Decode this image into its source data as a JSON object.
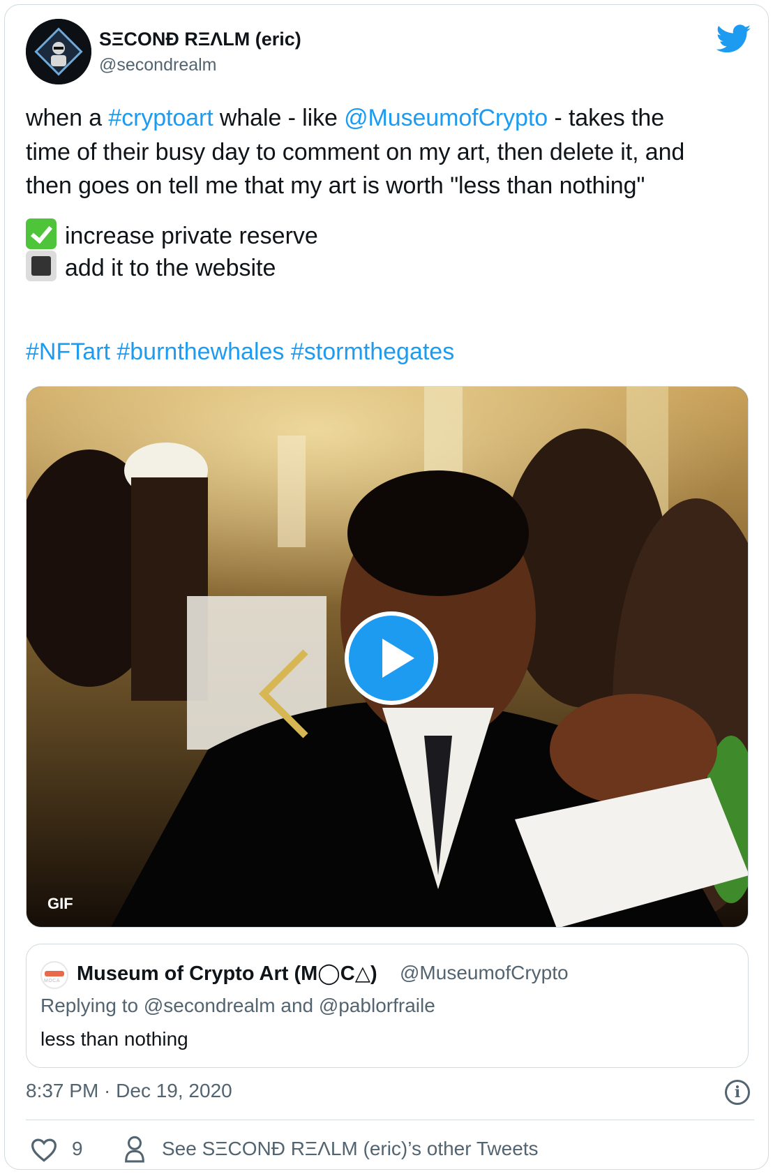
{
  "author": {
    "name": "SΞCONĐ RΞΛLM (eric)",
    "handle": "@secondrealm"
  },
  "tweet": {
    "line1": {
      "pre": "when a ",
      "tag": "#cryptoart",
      "mid": " whale - like ",
      "mention": "@MuseumofCrypto",
      "post": " - takes the"
    },
    "line2": "time of their busy day to comment on my art, then delete it, and",
    "line3": "then goes on tell me that my art is worth \"less than nothing\"",
    "checklist": [
      {
        "icon": "check-mark-button-emoji",
        "text": "increase private reserve"
      },
      {
        "icon": "black-square-button-emoji",
        "text": "add it to the website"
      }
    ],
    "hashtags": "#NFTart #burnthewhales #stormthegates"
  },
  "media": {
    "badge": "GIF",
    "play_icon": "play-icon"
  },
  "quoted": {
    "name": "Museum of Crypto Art (M◯C△)",
    "handle": "@MuseumofCrypto",
    "replying": "Replying to @secondrealm and @pablorfraile",
    "text": "less than nothing"
  },
  "meta": {
    "timestamp": "8:37 PM · Dec 19, 2020",
    "info_glyph": "i"
  },
  "actions": {
    "likes": "9",
    "other_tweets": "See SΞCONĐ RΞΛLM (eric)’s other Tweets"
  },
  "colors": {
    "link": "#1d9bf0",
    "text": "#0f1419",
    "muted": "#536471",
    "border": "#cfd9de"
  }
}
